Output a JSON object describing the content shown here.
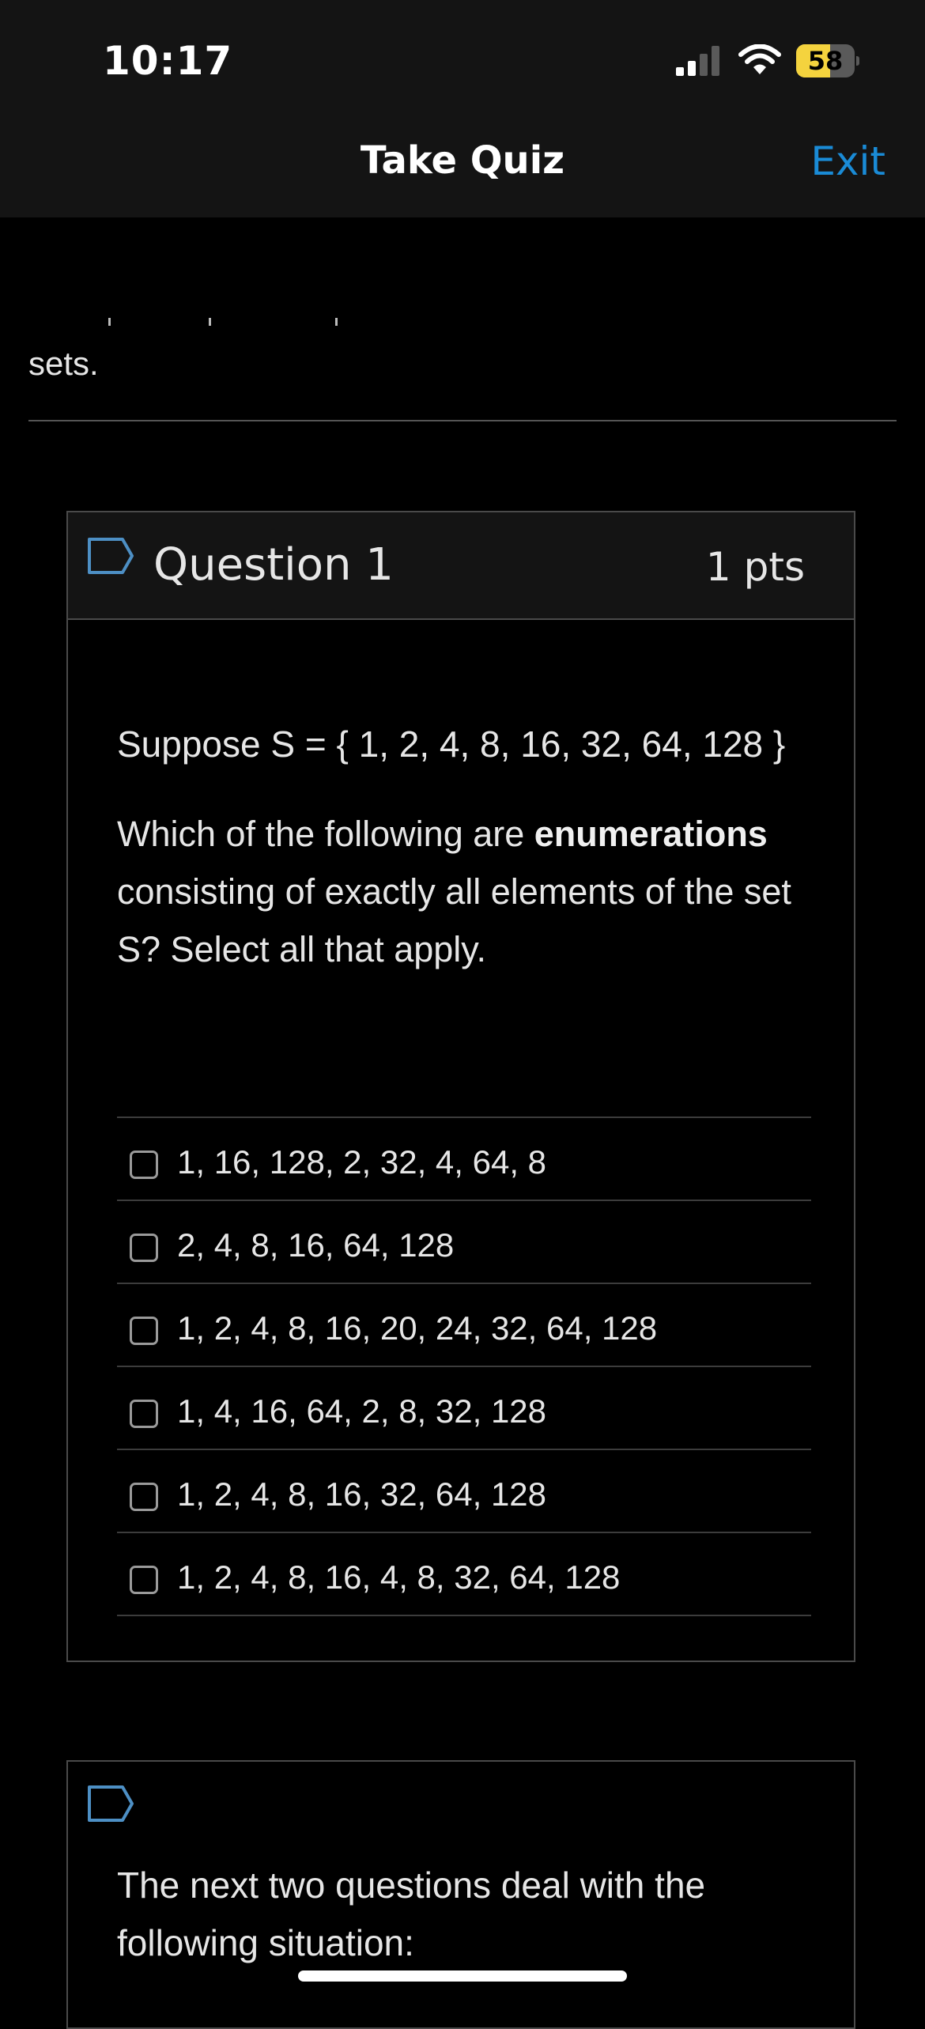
{
  "status_bar": {
    "time": "10:17",
    "battery_level": "58",
    "battery_fraction": 0.58,
    "signal_bars_active": 2,
    "signal_bars_total": 4,
    "icons": [
      "signal-icon",
      "wifi-icon",
      "battery-icon"
    ]
  },
  "nav": {
    "title": "Take Quiz",
    "exit_label": "Exit"
  },
  "intro": {
    "tail_text": "sets."
  },
  "question": {
    "title": "Question 1",
    "points": "1 pts",
    "setup": "Suppose S = { 1, 2, 4, 8, 16, 32, 64, 128 }",
    "prompt_start": "Which of the following are ",
    "prompt_emphasis": "enumerations",
    "prompt_end": " consisting of exactly all elements of the set S? Select all that apply.",
    "answers": [
      {
        "label": "1, 16, 128, 2, 32, 4, 64, 8",
        "checked": false
      },
      {
        "label": "2, 4, 8, 16, 64, 128",
        "checked": false
      },
      {
        "label": "1, 2, 4, 8, 16, 20, 24, 32, 64, 128",
        "checked": false
      },
      {
        "label": "1, 4, 16, 64, 2, 8, 32, 128",
        "checked": false
      },
      {
        "label": "1, 2, 4, 8, 16, 32, 64, 128",
        "checked": false
      },
      {
        "label": "1, 2, 4, 8, 16, 4, 8, 32, 64, 128",
        "checked": false
      }
    ]
  },
  "next_block": {
    "text": "The next two questions deal with the following situation:"
  },
  "colors": {
    "accent": "#1a8bd6",
    "flag_outline": "#4d8fc4",
    "battery_fill": "#f4d33e",
    "background": "#000000",
    "bar_background": "#141414"
  }
}
